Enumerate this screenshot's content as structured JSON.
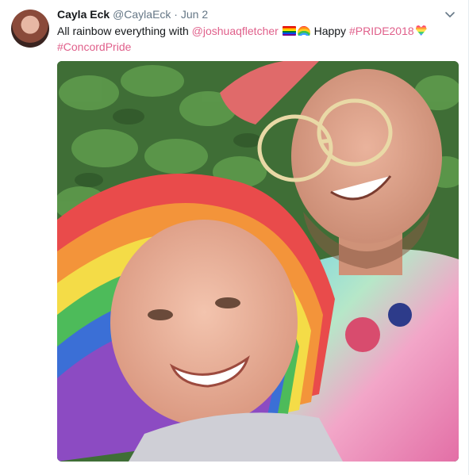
{
  "tweet": {
    "display_name": "Cayla Eck",
    "handle": "@CaylaEck",
    "separator": "·",
    "date": "Jun 2",
    "text_part1": "All rainbow everything with ",
    "mention": "@joshuaqfletcher",
    "text_part2": " Happy ",
    "hashtag1": "#PRIDE2018",
    "hashtag2": "#ConcordPride",
    "emoji": [
      "rainbow-flag-icon",
      "rainbow-icon",
      "rainbow-heart-icon"
    ],
    "photo_icon": "selfie-photo",
    "colors": {
      "link": "#e0608b",
      "name": "#14171a",
      "muted": "#657786"
    }
  }
}
